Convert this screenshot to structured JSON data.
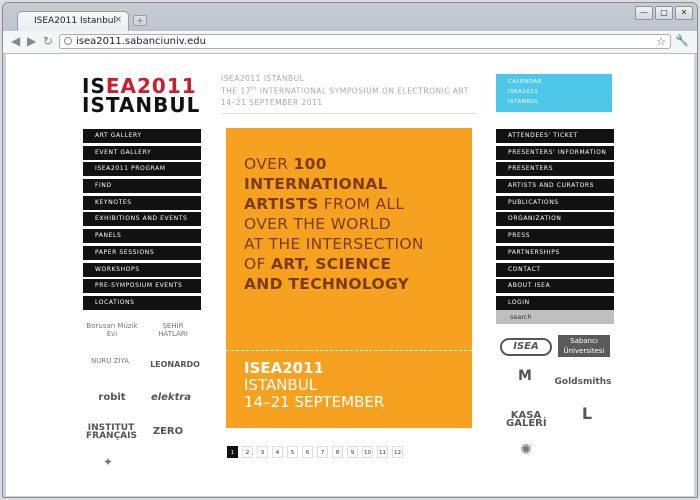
{
  "browser": {
    "tab_title": "ISEA2011 Istanbul",
    "tab_close": "×",
    "new_tab": "+",
    "url": "isea2011.sabanciuniv.edu",
    "win_min": "—",
    "win_max": "□",
    "win_close": "✕"
  },
  "header": {
    "logo_line1_a": "IS",
    "logo_line1_b": "EA2011",
    "logo_line2": "ISTANBUL",
    "tagline_1": "ISEA2011 ISTANBUL",
    "tagline_2a": "THE 17",
    "tagline_2sup": "th",
    "tagline_2b": " INTERNATIONAL SYMPOSIUM ON ELECTRONIC ART",
    "tagline_3": "14–21 SEPTEMBER 2011"
  },
  "left_menu": [
    "ART GALLERY",
    "EVENT GALLERY",
    "ISEA2011 PROGRAM",
    "FIND",
    "KEYNOTES",
    "EXHIBITIONS AND EVENTS",
    "PANELS",
    "PAPER SESSIONS",
    "WORKSHOPS",
    "PRE-SYMPOSIUM EVENTS",
    "LOCATIONS"
  ],
  "calendar": [
    "CALENDAR",
    "ISEA2011",
    "ISTANBUL"
  ],
  "right_menu": [
    "ATTENDEES' TICKET",
    "PRESENTERS' INFORMATION",
    "PRESENTERS",
    "ARTISTS AND CURATORS",
    "PUBLICATIONS",
    "ORGANIZATION",
    "PRESS",
    "PARTNERSHIPS",
    "CONTACT",
    "ABOUT ISEA",
    "LOGIN"
  ],
  "search": {
    "label": "search"
  },
  "poster": {
    "l1a": "OVER ",
    "l1b": "100",
    "l2": "INTERNATIONAL",
    "l3a": "ARTISTS",
    "l3b": " FROM ALL",
    "l4": "OVER THE WORLD",
    "l5": "AT THE INTERSECTION",
    "l6a": "OF ",
    "l6b": "ART, SCIENCE",
    "l7": "AND TECHNOLOGY",
    "b1": "ISEA2011",
    "b2": "ISTANBUL",
    "b3": "14–21 SEPTEMBER"
  },
  "pager": [
    "1",
    "2",
    "3",
    "4",
    "5",
    "6",
    "7",
    "8",
    "9",
    "10",
    "11",
    "12"
  ],
  "sponsors_left": {
    "borusan": "Borusan Müzik Evi",
    "sehir": "ŞEHİR HATLARI",
    "nuru": "NURU ZİYA",
    "leonardo": "LEONARDO",
    "robit": "robit",
    "elektra": "elektra",
    "institut": "INSTITUT FRANÇAIS",
    "zero": "ZERO"
  },
  "sponsors_right": {
    "isea": "ISEA",
    "sabanci": "Sabancı Üniversitesi",
    "goldsmiths": "Goldsmiths",
    "kasa": "KASA GALERİ"
  }
}
